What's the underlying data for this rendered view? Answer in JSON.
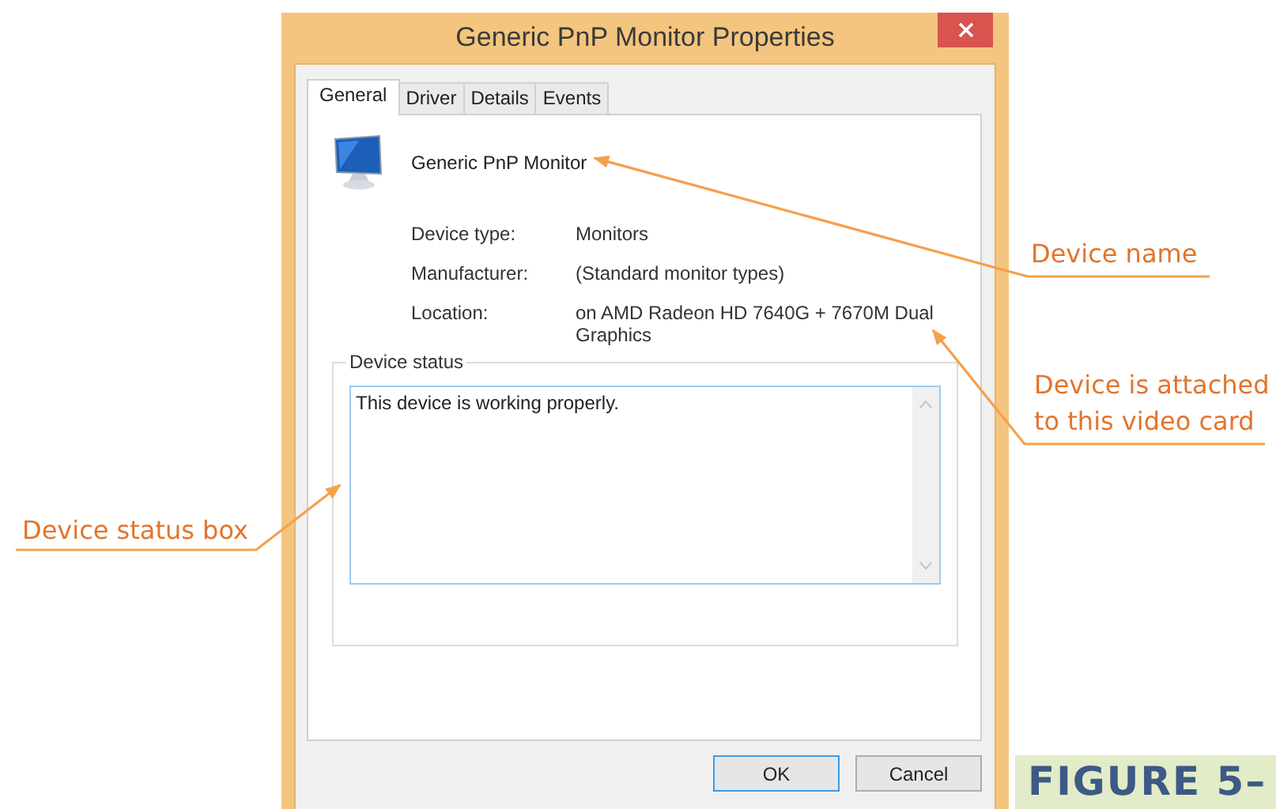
{
  "window": {
    "title": "Generic PnP Monitor Properties"
  },
  "tabs": [
    {
      "label": "General",
      "selected": true
    },
    {
      "label": "Driver",
      "selected": false
    },
    {
      "label": "Details",
      "selected": false
    },
    {
      "label": "Events",
      "selected": false
    }
  ],
  "device": {
    "name": "Generic PnP Monitor",
    "properties": [
      {
        "label": "Device type:",
        "value": "Monitors"
      },
      {
        "label": "Manufacturer:",
        "value": "(Standard monitor types)"
      },
      {
        "label": "Location:",
        "value": "on AMD Radeon HD 7640G + 7670M Dual Graphics"
      }
    ]
  },
  "device_status": {
    "legend": "Device status",
    "text": "This device is working properly."
  },
  "buttons": [
    {
      "label": "OK",
      "default": true
    },
    {
      "label": "Cancel",
      "default": false
    }
  ],
  "callouts": [
    {
      "lines": [
        "Device name"
      ]
    },
    {
      "lines": [
        "Device is attached",
        "to this video card"
      ]
    },
    {
      "lines": [
        "Device status box"
      ]
    }
  ],
  "figure_label": "FIGURE 5–"
}
